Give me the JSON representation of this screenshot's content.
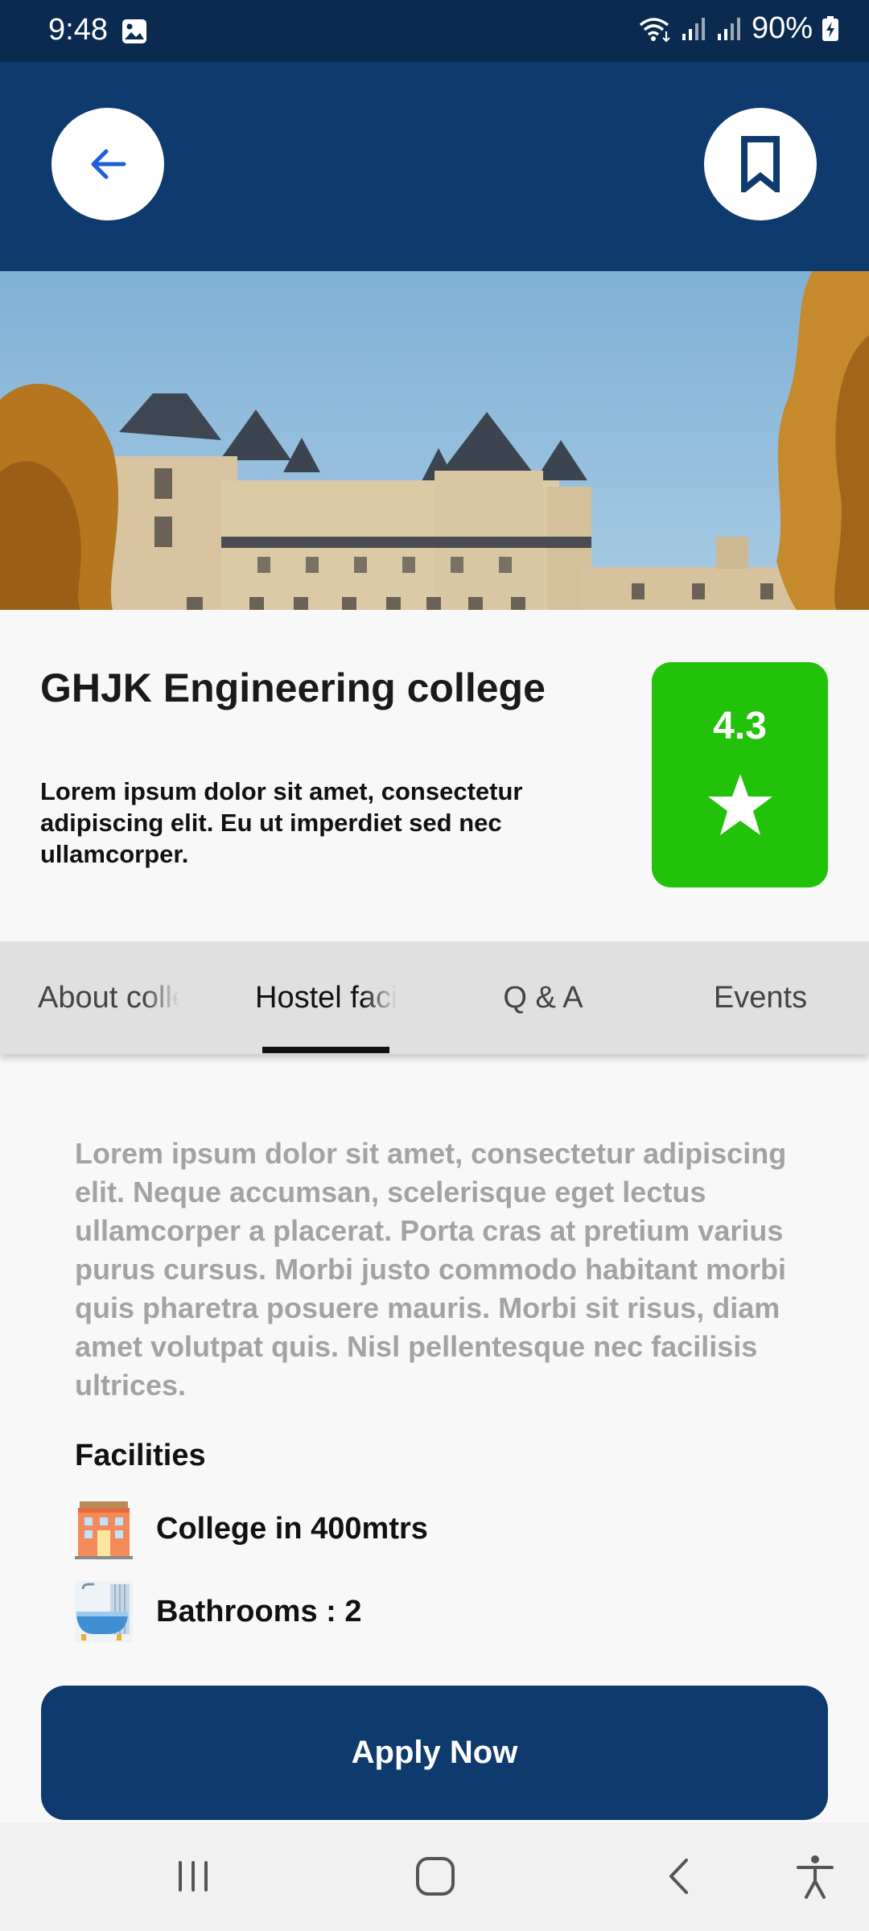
{
  "status_bar": {
    "time": "9:48",
    "battery": "90%",
    "icons": [
      "photo-icon",
      "wifi-icon",
      "signal-icon",
      "signal-icon",
      "battery-charging-icon"
    ]
  },
  "header": {
    "back_icon": "arrow-left-icon",
    "bookmark_icon": "bookmark-icon"
  },
  "college": {
    "name": "GHJK Engineering college",
    "description": "Lorem ipsum dolor sit amet, consectetur adipiscing elit. Eu ut imperdiet sed nec ullamcorper.",
    "rating": "4.3",
    "rating_color": "#22c10a"
  },
  "tabs": [
    {
      "label": "About college",
      "active": false
    },
    {
      "label": "Hostel facilities",
      "active": true
    },
    {
      "label": "Q & A",
      "active": false
    },
    {
      "label": "Events",
      "active": false
    }
  ],
  "hostel": {
    "description": "Lorem ipsum dolor sit amet, consectetur adipiscing elit. Neque accumsan, scelerisque eget lectus ullamcorper a placerat. Porta cras at pretium varius purus cursus. Morbi justo commodo habitant morbi quis pharetra posuere mauris. Morbi sit risus, diam amet volutpat quis. Nisl pellentesque nec facilisis ultrices.",
    "facilities_heading": "Facilities",
    "facilities": [
      {
        "icon": "building-icon",
        "label": "College in 400mtrs"
      },
      {
        "icon": "bathtub-icon",
        "label": "Bathrooms : 2"
      }
    ]
  },
  "apply_button": "Apply Now",
  "colors": {
    "primary": "#0e3a6d",
    "status_bar": "#0a2a4f",
    "accent_blue": "#1f5fd6"
  },
  "nav_bar": {
    "icons": [
      "recents-icon",
      "home-icon",
      "back-icon",
      "accessibility-icon"
    ]
  }
}
